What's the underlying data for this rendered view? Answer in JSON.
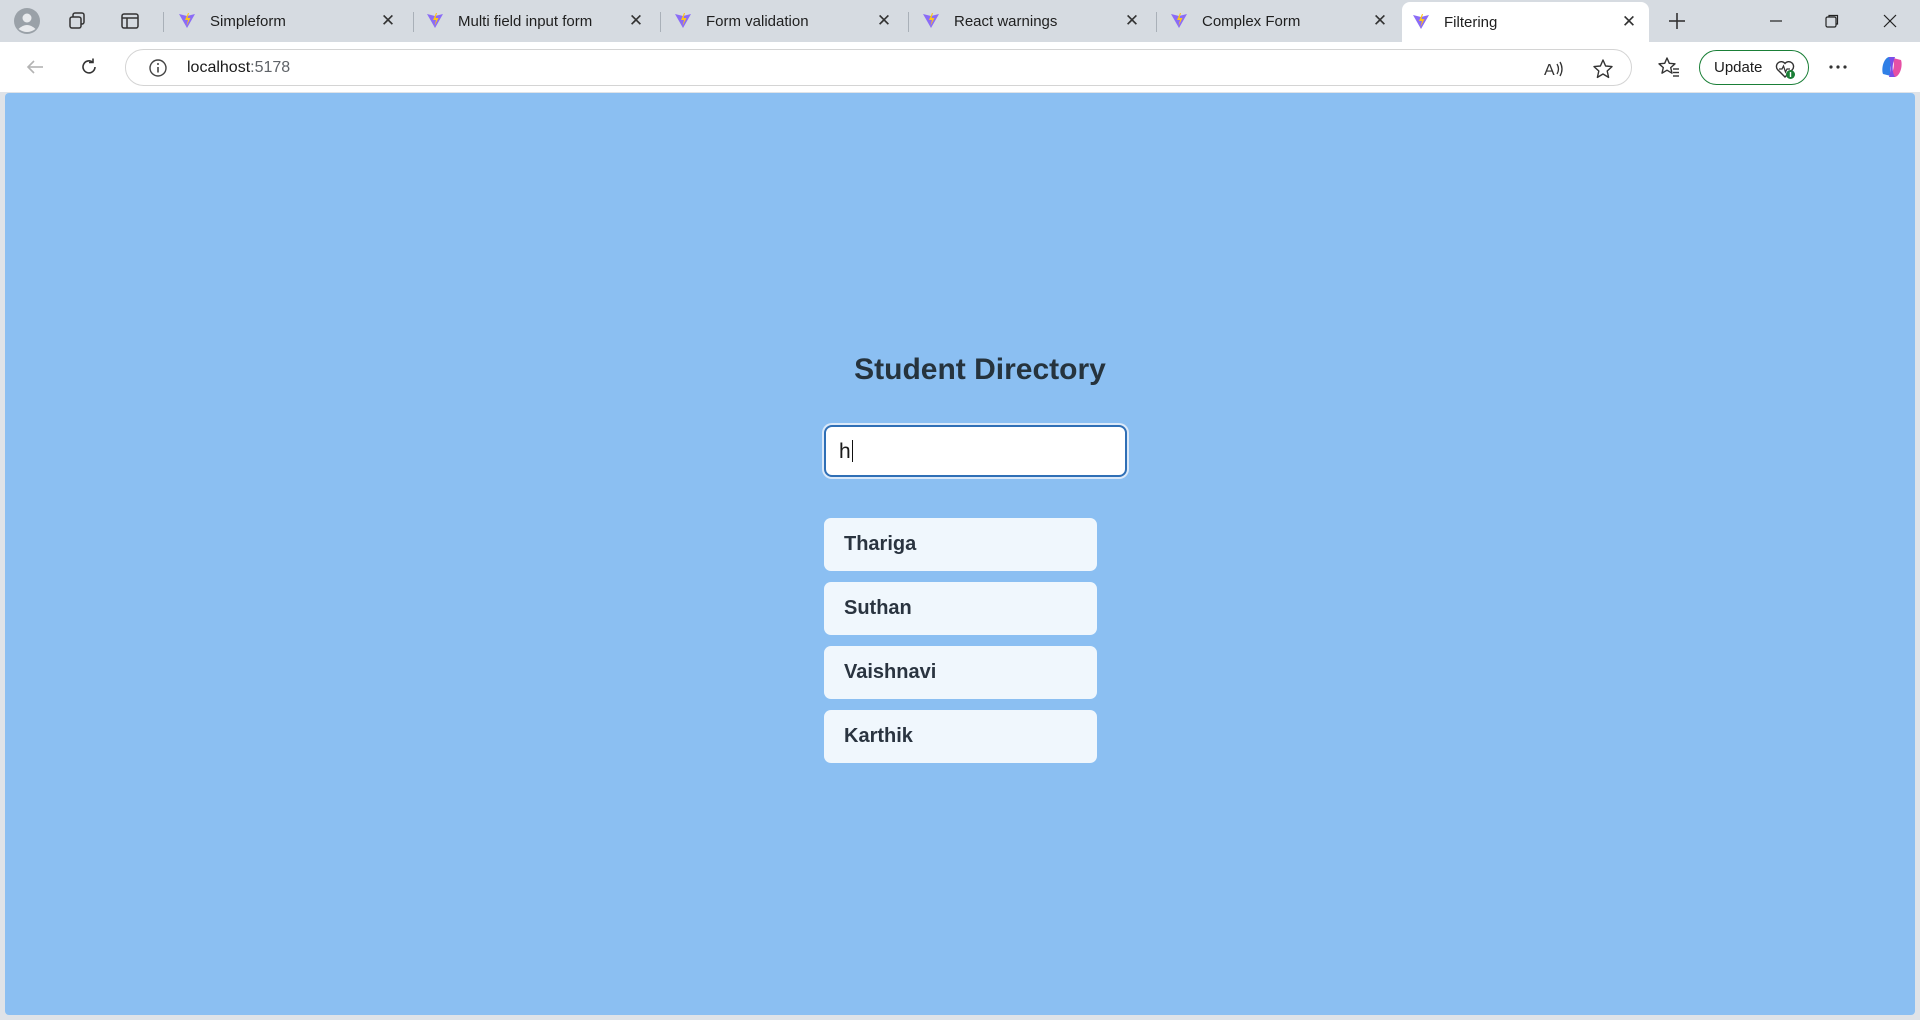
{
  "browser": {
    "tabs": [
      {
        "title": "Simpleform",
        "active": false
      },
      {
        "title": "Multi field input form",
        "active": false
      },
      {
        "title": "Form validation",
        "active": false
      },
      {
        "title": "React warnings",
        "active": false
      },
      {
        "title": "Complex Form",
        "active": false
      },
      {
        "title": "Filtering",
        "active": true
      }
    ],
    "address": {
      "host": "localhost",
      "port": ":5178"
    },
    "update_label": "Update",
    "icons": {
      "profile": "profile-icon",
      "workspaces": "workspaces-icon",
      "tab_actions": "tab-actions-icon",
      "new_tab": "plus-icon",
      "minimize": "minimize-icon",
      "restore": "restore-icon",
      "close": "close-icon",
      "back": "back-arrow-icon",
      "reload": "reload-icon",
      "site_info": "info-icon",
      "read_aloud": "read-aloud-icon",
      "favorite": "star-icon",
      "favorites": "favorites-icon",
      "browser_essentials": "heart-pulse-icon",
      "more": "more-icon",
      "copilot": "copilot-icon"
    }
  },
  "page": {
    "title": "Student Directory",
    "search_value": "h",
    "students": [
      "Thariga",
      "Suthan",
      "Vaishnavi",
      "Karthik"
    ]
  },
  "colors": {
    "page_background": "#8bbff2",
    "card_background": "#f0f7fd",
    "title_text": "#26333d",
    "search_border": "#2f6fb6",
    "update_border": "#1a7f37"
  }
}
